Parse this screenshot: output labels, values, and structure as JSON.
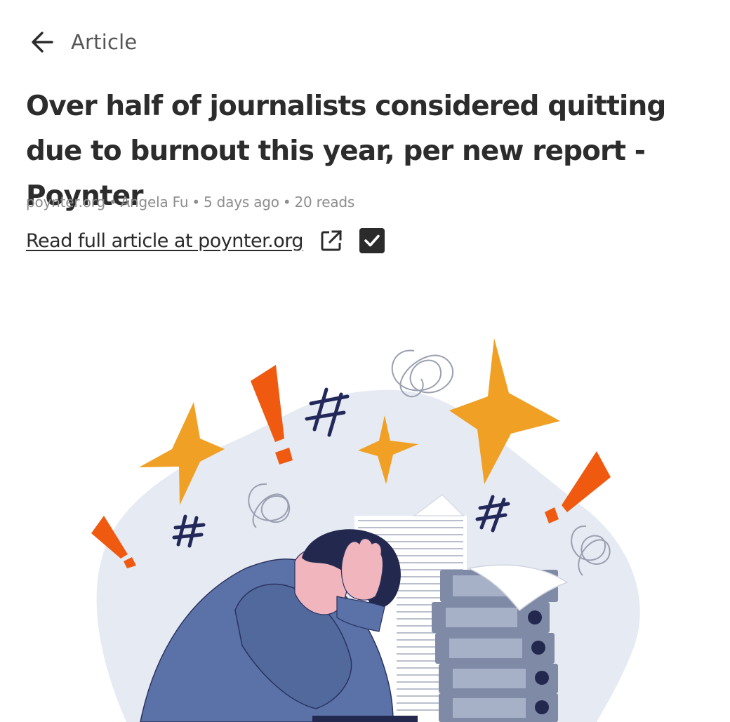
{
  "header": {
    "title": "Article",
    "back_icon": "arrow-left-icon"
  },
  "article": {
    "headline": "Over half of journalists considered quitting due to burnout this year, per new report - Poynter",
    "source": "poynter.org",
    "author": "Angela Fu",
    "age": "5 days ago",
    "reads": "20 reads",
    "separator": "•",
    "read_link": "Read full article at poynter.org",
    "external_icon": "external-link-icon",
    "read_checked": true
  },
  "colors": {
    "star": "#f0a024",
    "exclaim": "#ef5a10",
    "hash": "#23285a",
    "blob": "#e6eaf3",
    "shirt": "#5a72a8",
    "hair": "#23284f",
    "skin": "#f0b5bd",
    "folder": "#7f8aa6"
  }
}
